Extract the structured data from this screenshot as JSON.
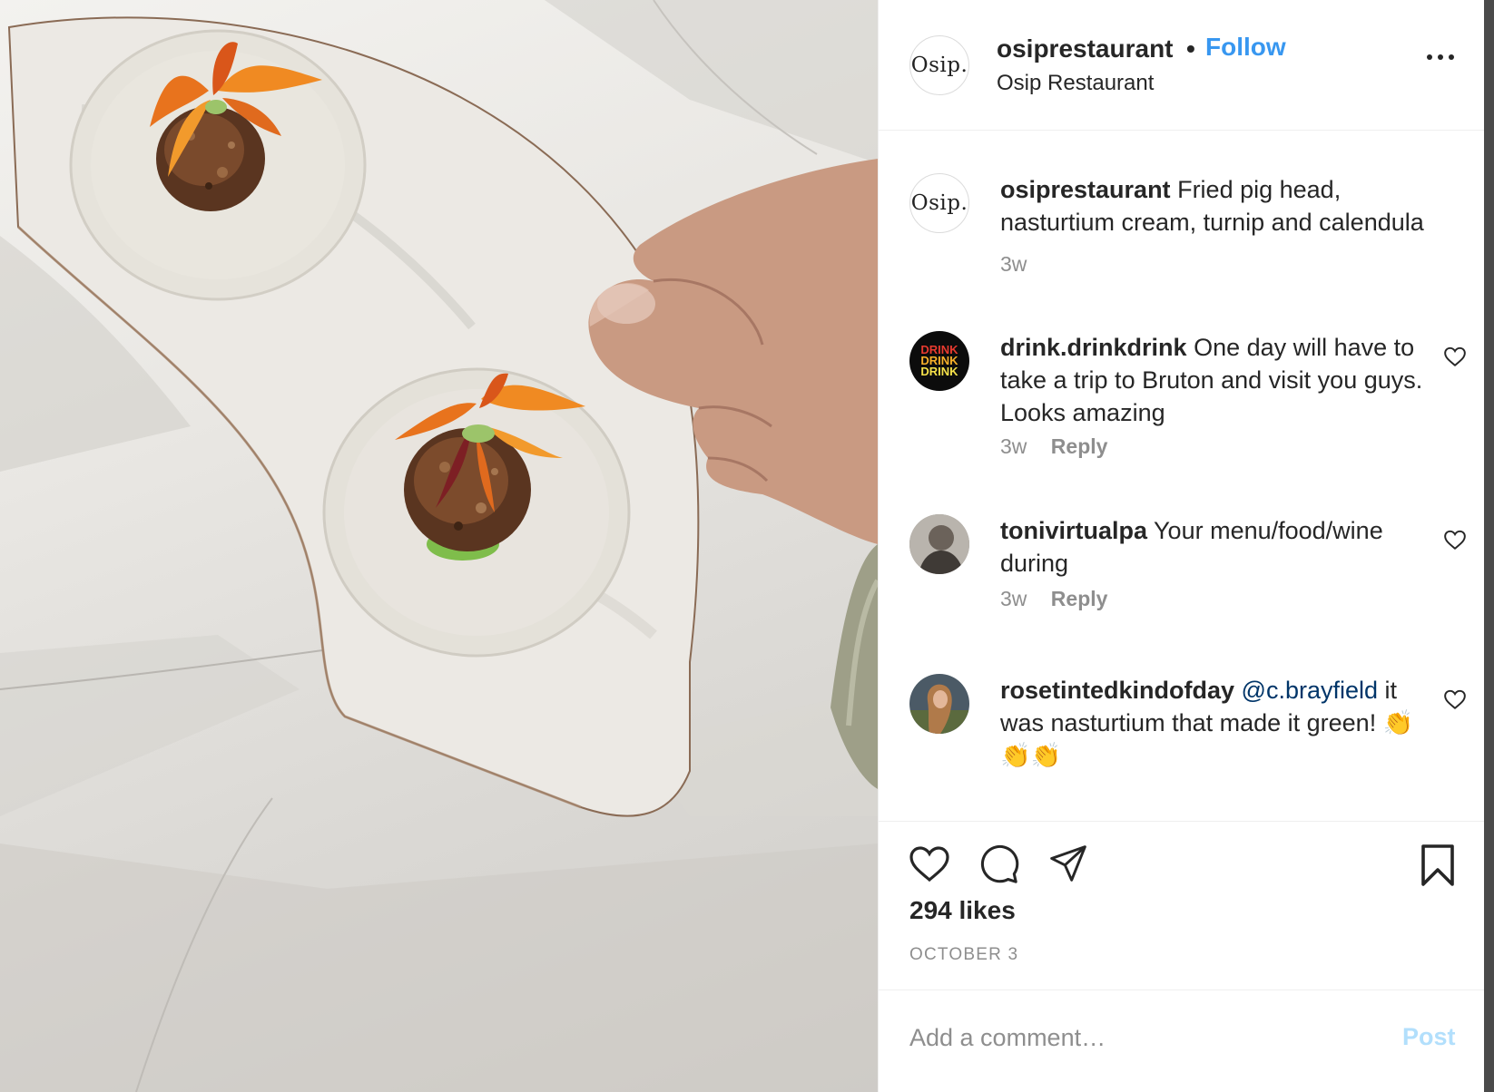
{
  "post": {
    "username": "osiprestaurant",
    "separator": "•",
    "follow_label": "Follow",
    "location": "Osip Restaurant",
    "avatar_text": "Osip."
  },
  "caption": {
    "username": "osiprestaurant",
    "text": "Fried pig head, nasturtium cream, turnip and calendula",
    "time": "3w"
  },
  "comments": [
    {
      "username": "drink.drinkdrink",
      "text": "One day will have to take a trip to Bruton and visit you guys. Looks amazing",
      "time": "3w",
      "reply_label": "Reply",
      "avatar_lines": [
        "DRINK",
        "DRINK",
        "DRINK"
      ]
    },
    {
      "username": "tonivirtualpa",
      "text": "Your menu/food/wine during",
      "time": "3w",
      "reply_label": "Reply"
    },
    {
      "username": "rosetintedkindofday",
      "mention": "@c.brayfield",
      "text": "it was nasturtium that made it green! 👏👏👏"
    }
  ],
  "actions": {
    "likes": "294 likes",
    "date": "OCTOBER 3",
    "icons": [
      "heart-icon",
      "comment-icon",
      "share-icon",
      "bookmark-icon"
    ]
  },
  "add_comment": {
    "placeholder": "Add a comment…",
    "post_label": "Post"
  },
  "colors": {
    "follow": "#3897f0",
    "post_disabled": "#b2dffc",
    "mention": "#003569",
    "muted": "#8e8e8e"
  }
}
